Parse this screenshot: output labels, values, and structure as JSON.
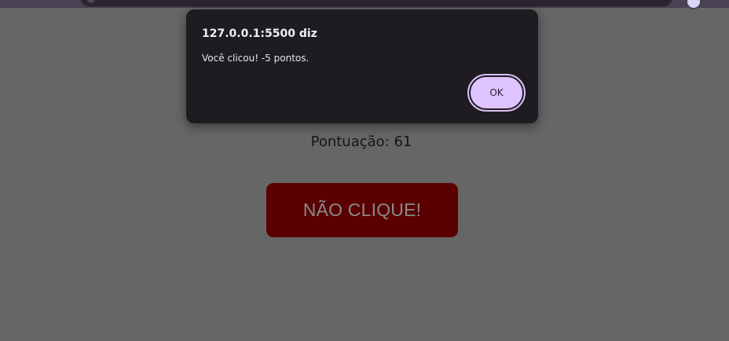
{
  "alert": {
    "title": "127.0.0.1:5500 diz",
    "message": "Você clicou! -5 pontos.",
    "ok_label": "OK"
  },
  "page": {
    "score_text": "Pontuação: 61",
    "button_label": "NÃO CLIQUE!"
  },
  "colors": {
    "page_background": "#666666",
    "dialog_background": "#1f1c21",
    "ok_button": "#dec4ff",
    "danger_button": "#5a0000"
  }
}
